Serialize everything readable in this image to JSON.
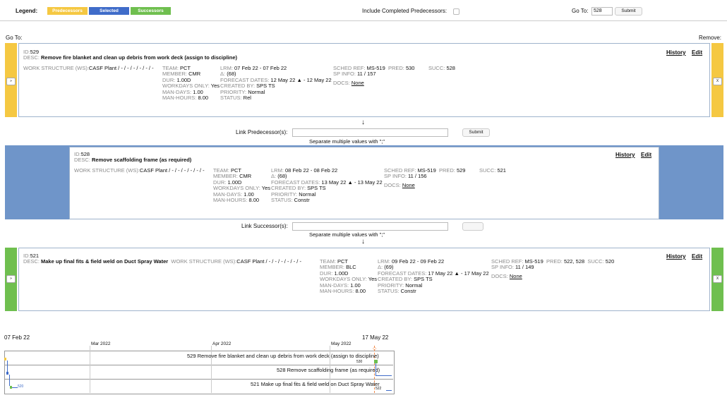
{
  "legend": {
    "label": "Legend:",
    "predecessors": "Predecessors",
    "selected": "Selected",
    "successors": "Successors",
    "colors": {
      "predecessors": "#f5c842",
      "selected": "#3f6cc9",
      "successors": "#6fbf4f"
    }
  },
  "include_completed": "Include Completed Predecessors:",
  "goto": {
    "label": "Go To:",
    "value": "528",
    "submit": "Submit"
  },
  "goto_left": "Go To:",
  "remove": "Remove:",
  "pred_card": {
    "id_label": "ID:",
    "id": "529",
    "desc_label": "DESC:",
    "desc": "Remove fire blanket and clean up debris from work deck (assign to discipline)",
    "history": "History",
    "edit": "Edit",
    "ws_label": "WORK STRUCTURE (WS):",
    "ws": "CASF Plant / - / - / - / - / - / -",
    "team_label": "TEAM:",
    "team": "PCT",
    "member_label": "MEMBER:",
    "member": "CMR",
    "dur_label": "DUR:",
    "dur": "1.00D",
    "workdays_label": "WORKDAYS ONLY:",
    "workdays": "Yes",
    "mandays_label": "MAN-DAYS:",
    "mandays": "1.00",
    "manhours_label": "MAN-HOURS:",
    "manhours": "8.00",
    "lrm_label": "LRM:",
    "lrm": "07 Feb 22 - 07 Feb 22",
    "delta_label": "Δ:",
    "delta": "(68)",
    "forecast_label": "FORECAST DATES:",
    "forecast": "12 May 22 ▲ - 12 May 22",
    "created_label": "CREATED BY:",
    "created": "SPS TS",
    "priority_label": "PRIORITY:",
    "priority": "Normal",
    "status_label": "STATUS:",
    "status": "Rel",
    "schedref_label": "SCHED REF:",
    "schedref": "MS-519",
    "pred_label": "PRED:",
    "pred": "530",
    "succ_label": "SUCC:",
    "succ": "528",
    "spinfo_label": "SP INFO:",
    "spinfo": "11 / 157",
    "docs_label": "DOCS:",
    "docs": "None",
    "side_btn": "»",
    "remove_btn": "X"
  },
  "link_pred": {
    "label": "Link Predecessor(s):",
    "submit": "Submit",
    "hint": "Separate multiple values with \";\""
  },
  "sel_card": {
    "id_label": "ID:",
    "id": "528",
    "desc_label": "DESC:",
    "desc": "Remove scaffolding frame (as required)",
    "history": "History",
    "edit": "Edit",
    "ws_label": "WORK STRUCTURE (WS):",
    "ws": "CASF Plant / - / - / - / - / - / -",
    "team_label": "TEAM:",
    "team": "PCT",
    "member_label": "MEMBER:",
    "member": "CMR",
    "dur_label": "DUR:",
    "dur": "1.00D",
    "workdays_label": "WORKDAYS ONLY:",
    "workdays": "Yes",
    "mandays_label": "MAN-DAYS:",
    "mandays": "1.00",
    "manhours_label": "MAN-HOURS:",
    "manhours": "8.00",
    "lrm_label": "LRM:",
    "lrm": "08 Feb 22 - 08 Feb 22",
    "delta_label": "Δ:",
    "delta": "(68)",
    "forecast_label": "FORECAST DATES:",
    "forecast": "13 May 22 ▲ - 13 May 22",
    "created_label": "CREATED BY:",
    "created": "SPS TS",
    "priority_label": "PRIORITY:",
    "priority": "Normal",
    "status_label": "STATUS:",
    "status": "Constr",
    "schedref_label": "SCHED REF:",
    "schedref": "MS-519",
    "pred_label": "PRED:",
    "pred": "529",
    "succ_label": "SUCC:",
    "succ": "521",
    "spinfo_label": "SP INFO:",
    "spinfo": "11 / 156",
    "docs_label": "DOCS:",
    "docs": "None"
  },
  "link_succ": {
    "label": "Link Successor(s):",
    "hint": "Separate multiple values with \";\""
  },
  "succ_card": {
    "id_label": "ID:",
    "id": "521",
    "desc_label": "DESC:",
    "desc": "Make up final fits & field weld on Duct Spray Water",
    "history": "History",
    "edit": "Edit",
    "ws_label": "WORK STRUCTURE (WS):",
    "ws": "CASF Plant / - / - / - / - / - / -",
    "team_label": "TEAM:",
    "team": "PCT",
    "member_label": "MEMBER:",
    "member": "BLC",
    "dur_label": "DUR:",
    "dur": "1.00D",
    "workdays_label": "WORKDAYS ONLY:",
    "workdays": "Yes",
    "mandays_label": "MAN-DAYS:",
    "mandays": "1.00",
    "manhours_label": "MAN-HOURS:",
    "manhours": "8.00",
    "lrm_label": "LRM:",
    "lrm": "09 Feb 22 - 09 Feb 22",
    "delta_label": "Δ:",
    "delta": "(69)",
    "forecast_label": "FORECAST DATES:",
    "forecast": "17 May 22 ▲ - 17 May 22",
    "created_label": "CREATED BY:",
    "created": "SPS TS",
    "priority_label": "PRIORITY:",
    "priority": "Normal",
    "status_label": "STATUS:",
    "status": "Constr",
    "schedref_label": "SCHED REF:",
    "schedref": "MS-519",
    "pred_label": "PRED:",
    "pred": "522, 528",
    "succ_label": "SUCC:",
    "succ": "520",
    "spinfo_label": "SP INFO:",
    "spinfo": "11 / 149",
    "docs_label": "DOCS:",
    "docs": "None",
    "side_btn": "»",
    "remove_btn": "X"
  },
  "gantt": {
    "start_date": "07 Feb 22",
    "end_date": "17 May 22",
    "months": [
      "Mar 2022",
      "Apr 2022",
      "May 2022"
    ],
    "rows": [
      "529 Remove fire blanket and clean up debris from work deck (assign to discipline)",
      "528 Remove scaffolding frame (as required)",
      "521 Make up final fits & field weld on Duct Spray Water"
    ],
    "markers": {
      "m530": "530",
      "m520": "520",
      "m522": "522"
    }
  }
}
